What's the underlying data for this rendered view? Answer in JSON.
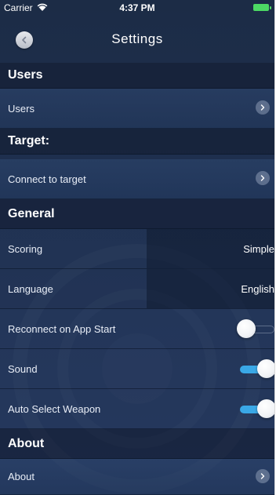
{
  "status_bar": {
    "carrier": "Carrier",
    "time": "4:37 PM",
    "wifi_icon": "wifi-icon",
    "battery_icon": "battery-icon",
    "battery_color": "#4cd964"
  },
  "nav": {
    "title": "Settings",
    "back_icon": "chevron-left-icon"
  },
  "sections": {
    "users": {
      "header": "Users",
      "users_label": "Users"
    },
    "target": {
      "header": "Target:",
      "connect_label": "Connect to target"
    },
    "general": {
      "header": "General",
      "scoring_label": "Scoring",
      "scoring_value": "Simple",
      "language_label": "Language",
      "language_value": "English",
      "reconnect_label": "Reconnect on App Start",
      "reconnect_on": false,
      "sound_label": "Sound",
      "sound_on": true,
      "auto_select_label": "Auto Select Weapon",
      "auto_select_on": true
    },
    "about": {
      "header": "About",
      "about_label": "About"
    }
  },
  "colors": {
    "toggle_on": "#3aa8e6",
    "background": "#1f3050"
  }
}
